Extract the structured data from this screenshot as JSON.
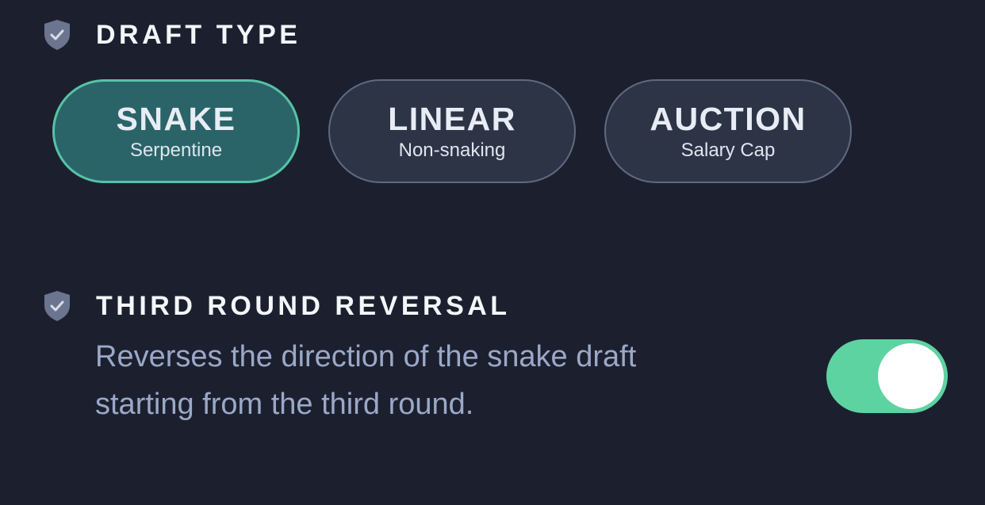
{
  "draft_type": {
    "title": "DRAFT TYPE",
    "icon": "shield-check-icon",
    "options": [
      {
        "label": "SNAKE",
        "sublabel": "Serpentine",
        "selected": true
      },
      {
        "label": "LINEAR",
        "sublabel": "Non-snaking",
        "selected": false
      },
      {
        "label": "AUCTION",
        "sublabel": "Salary Cap",
        "selected": false
      }
    ]
  },
  "third_round_reversal": {
    "title": "THIRD ROUND REVERSAL",
    "icon": "shield-check-icon",
    "description_line1": "Reverses the direction of the snake draft",
    "description_line2": "starting from the third round.",
    "enabled": true
  },
  "colors": {
    "background": "#1c202e",
    "selected_fill": "#2b6468",
    "selected_border": "#55c3a7",
    "pill_fill": "#2d3446",
    "pill_border": "#5e6a80",
    "toggle_on": "#5ed3a2",
    "description_text": "#9ba8c8"
  }
}
